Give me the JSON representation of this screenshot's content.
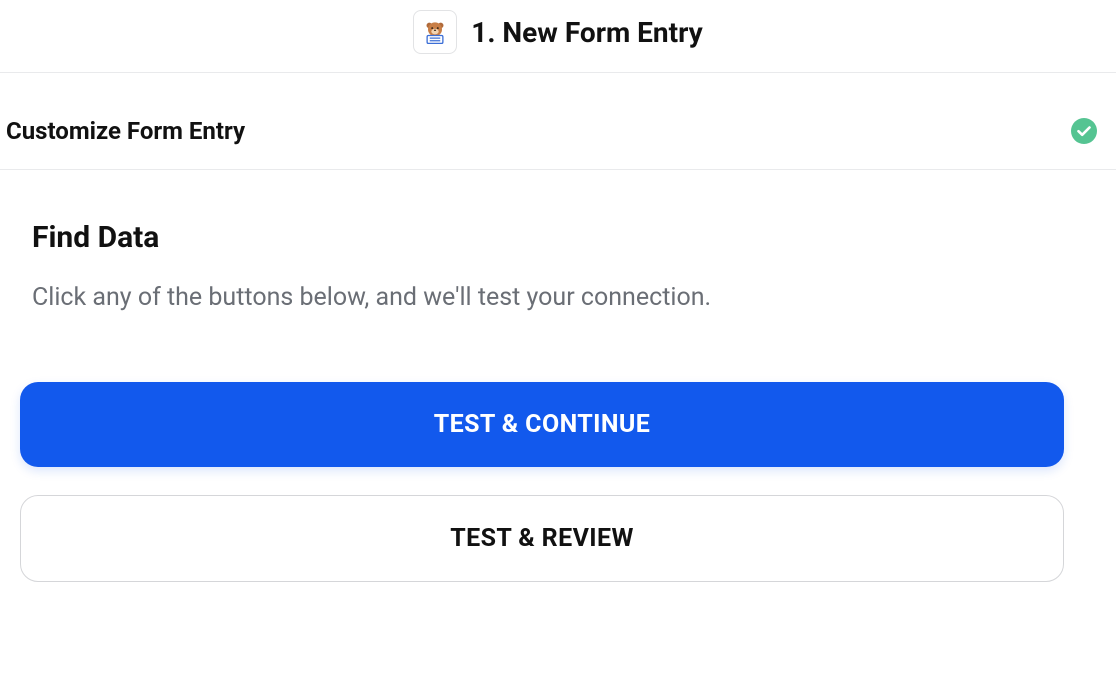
{
  "header": {
    "title": "1. New Form Entry",
    "app_icon": "bear-form-icon"
  },
  "section": {
    "label": "Customize Form Entry",
    "status": "complete"
  },
  "find_data": {
    "title": "Find Data",
    "description": "Click any of the buttons below, and we'll test your connection.",
    "primary_button": "TEST & CONTINUE",
    "secondary_button": "TEST & REVIEW"
  },
  "colors": {
    "primary": "#1259ed",
    "success": "#46c28e",
    "text_muted": "#6a6e75",
    "border": "#e9eaec"
  }
}
